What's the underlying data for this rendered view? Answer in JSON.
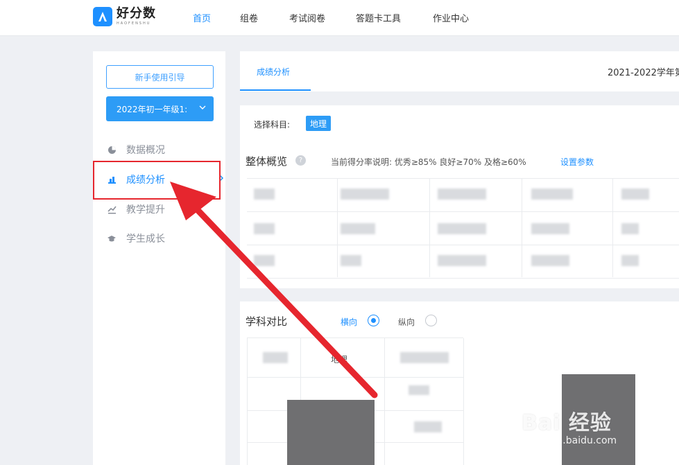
{
  "header": {
    "logo_name": "好分数",
    "logo_sub": "HAOFENSHU",
    "nav": [
      {
        "label": "首页",
        "active": true
      },
      {
        "label": "组卷",
        "active": false
      },
      {
        "label": "考试阅卷",
        "active": false
      },
      {
        "label": "答题卡工具",
        "active": false
      },
      {
        "label": "作业中心",
        "active": false
      }
    ]
  },
  "sidebar": {
    "guide_button": "新手使用引导",
    "grade_select": "2022年初一年级1:",
    "items": [
      {
        "label": "数据概况",
        "icon": "pie-chart-icon",
        "active": false
      },
      {
        "label": "成绩分析",
        "icon": "bar-chart-icon",
        "active": true
      },
      {
        "label": "教学提升",
        "icon": "trend-line-icon",
        "active": false
      },
      {
        "label": "学生成长",
        "icon": "graduation-cap-icon",
        "active": false
      }
    ]
  },
  "main": {
    "tab": "成绩分析",
    "year": "2021-2022学年第",
    "subject_label": "选择科目:",
    "subject_tag": "地理",
    "overview_title": "整体概览",
    "rate_note": "当前得分率说明:  优秀≥85%   良好≥70%   及格≥60%",
    "rate_link": "设置参数",
    "compare_title": "学科对比",
    "radio_horizontal": "横向",
    "radio_vertical": "纵向",
    "grid_header": "地理"
  },
  "watermark": {
    "text": "Bai 经验",
    "url": "jingyan.baidu.com"
  },
  "colors": {
    "accent": "#1e90ff",
    "highlight": "#e6262e"
  }
}
